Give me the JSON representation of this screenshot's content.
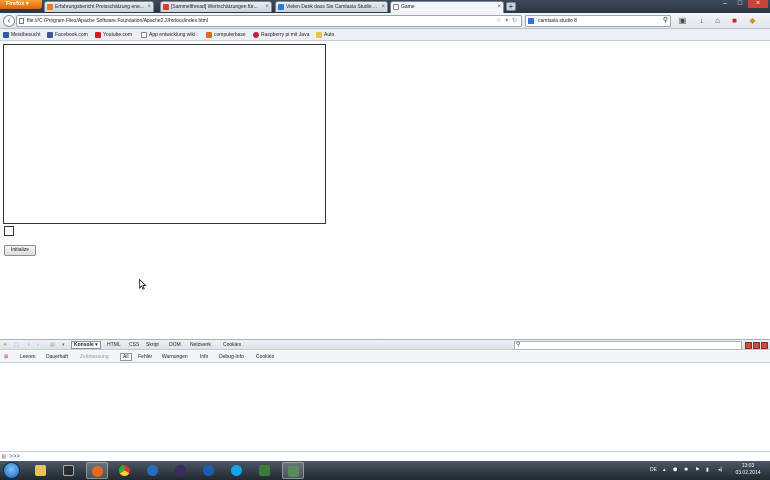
{
  "browser": {
    "app_button": "Firefox",
    "tabs": [
      {
        "label": "Erfahrungsbericht Preisschätzung ene...",
        "favicon_color": "#e87a2a"
      },
      {
        "label": "[Sammelthread] Wertschätzungen für...",
        "favicon_color": "#d93c2e"
      },
      {
        "label": "Vielen Dank dass Sie Camtasia Studio ...",
        "favicon_color": "#2b7bd6"
      },
      {
        "label": "Game",
        "favicon_color": "#ffffff",
        "active": true
      }
    ],
    "window_controls": [
      "–",
      "□",
      "×"
    ],
    "url": "file:///C:/Program Files/Apache Software Foundation/Apache2.2/htdocs/index.html",
    "search_value": "camtasia studio 8",
    "bookmarks": [
      {
        "label": "Meistbesucht",
        "color": "#2c5ea8"
      },
      {
        "label": "Facebook.com",
        "color": "#3b5998"
      },
      {
        "label": "Youtube.com",
        "color": "#cc2020"
      },
      {
        "label": "App entwicklung wiki",
        "color": "#ffffff"
      },
      {
        "label": "computerbase",
        "color": "#e06a20"
      },
      {
        "label": "Raspberry pi mit Java",
        "color": "#c0203c"
      },
      {
        "label": "Auto",
        "color": "#e8c24a"
      }
    ]
  },
  "page": {
    "initialize_label": "Initialize"
  },
  "firebug": {
    "toolbar": [
      "Konsole",
      "HTML",
      "CSS",
      "Skript",
      "DOM",
      "Netzwerk",
      "Cookies"
    ],
    "filters": [
      "Leeren",
      "Dauerhaft",
      "Zeitmessung",
      "All",
      "Fehler",
      "Warnungen",
      "Info",
      "Debug-Info",
      "Cookies"
    ],
    "selected_filter": "All",
    "command_prompt": ">>>"
  },
  "taskbar": {
    "language": "DE",
    "time": "13:03",
    "date": "03.02.2014"
  }
}
